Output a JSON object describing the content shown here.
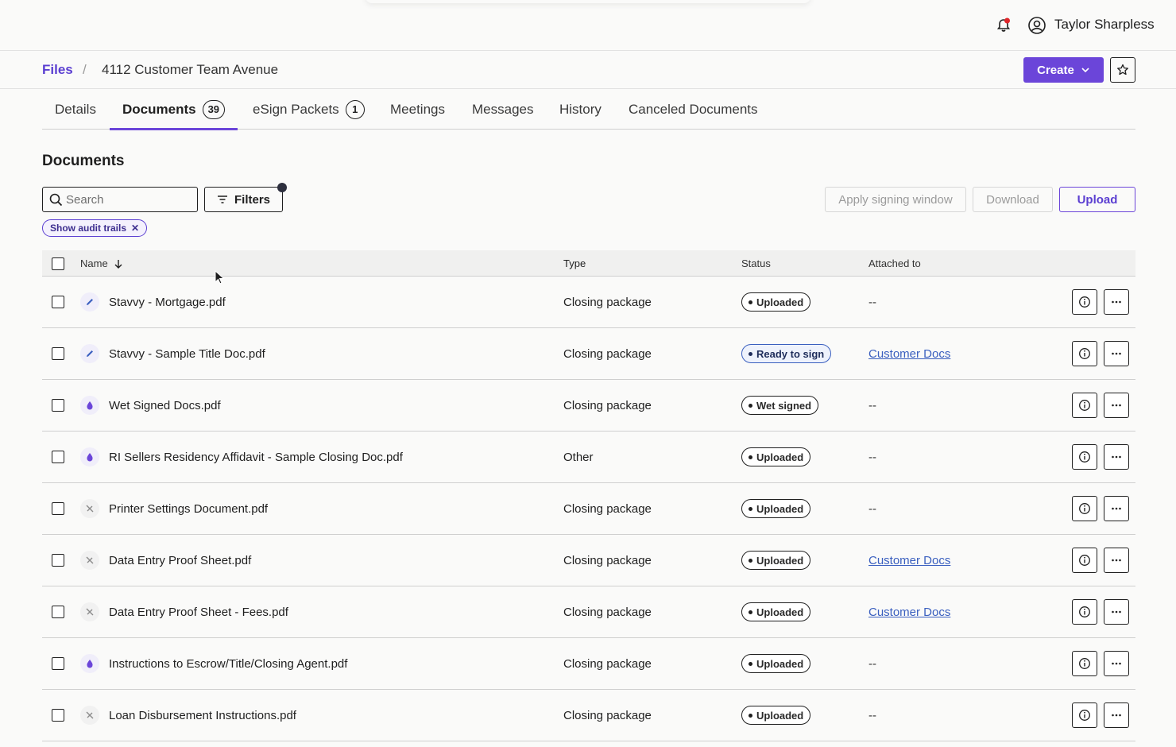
{
  "user": {
    "name": "Taylor Sharpless"
  },
  "breadcrumb": {
    "root": "Files",
    "separator": "/",
    "current": "4112 Customer Team Avenue"
  },
  "header_actions": {
    "create_label": "Create"
  },
  "tabs": [
    {
      "label": "Details"
    },
    {
      "label": "Documents",
      "count": "39"
    },
    {
      "label": "eSign Packets",
      "count": "1"
    },
    {
      "label": "Meetings"
    },
    {
      "label": "Messages"
    },
    {
      "label": "History"
    },
    {
      "label": "Canceled Documents"
    }
  ],
  "section": {
    "title": "Documents"
  },
  "toolbar": {
    "search_placeholder": "Search",
    "filters_label": "Filters",
    "apply_label": "Apply signing window",
    "download_label": "Download",
    "upload_label": "Upload"
  },
  "chip": {
    "label": "Show audit trails",
    "close": "✕"
  },
  "table": {
    "headers": {
      "name": "Name",
      "type": "Type",
      "status": "Status",
      "attached": "Attached to"
    },
    "rows": [
      {
        "icon": "pen-icon",
        "name": "Stavvy - Mortgage.pdf",
        "type": "Closing package",
        "status": "Uploaded",
        "attached": "--",
        "attached_link": false
      },
      {
        "icon": "pen-icon",
        "name": "Stavvy - Sample Title Doc.pdf",
        "type": "Closing package",
        "status": "Ready to sign",
        "attached": "Customer Docs",
        "attached_link": true
      },
      {
        "icon": "ink-drop-icon",
        "name": "Wet Signed Docs.pdf",
        "type": "Closing package",
        "status": "Wet signed",
        "attached": "--",
        "attached_link": false
      },
      {
        "icon": "ink-drop-icon",
        "name": "RI Sellers Residency Affidavit - Sample Closing Doc.pdf",
        "type": "Other",
        "status": "Uploaded",
        "attached": "--",
        "attached_link": false
      },
      {
        "icon": "no-sign-icon",
        "name": "Printer Settings Document.pdf",
        "type": "Closing package",
        "status": "Uploaded",
        "attached": "--",
        "attached_link": false
      },
      {
        "icon": "no-sign-icon",
        "name": "Data Entry Proof Sheet.pdf",
        "type": "Closing package",
        "status": "Uploaded",
        "attached": "Customer Docs",
        "attached_link": true
      },
      {
        "icon": "no-sign-icon",
        "name": "Data Entry Proof Sheet - Fees.pdf",
        "type": "Closing package",
        "status": "Uploaded",
        "attached": "Customer Docs",
        "attached_link": true
      },
      {
        "icon": "ink-drop-icon",
        "name": "Instructions to Escrow/Title/Closing Agent.pdf",
        "type": "Closing package",
        "status": "Uploaded",
        "attached": "--",
        "attached_link": false
      },
      {
        "icon": "no-sign-icon",
        "name": "Loan Disbursement Instructions.pdf",
        "type": "Closing package",
        "status": "Uploaded",
        "attached": "--",
        "attached_link": false
      }
    ]
  },
  "colors": {
    "accent": "#6b45d9",
    "link": "#3a5fbf",
    "notification": "#e0262a"
  }
}
